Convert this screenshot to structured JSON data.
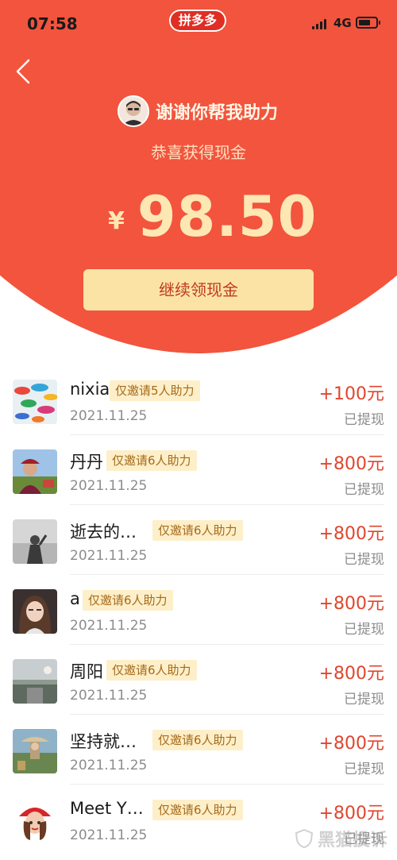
{
  "status_bar": {
    "time": "07:58",
    "app_badge": "拼多多",
    "network": "4G",
    "battery": 0.5
  },
  "back_icon": "chevron-left-icon",
  "header": {
    "thanks": "谢谢你帮我助力",
    "congrats": "恭喜获得现金",
    "currency": "¥",
    "amount": "98.50",
    "cta": "继续领现金"
  },
  "records": [
    {
      "name": "nixia",
      "tag": "仅邀请5人助力",
      "date": "2021.11.25",
      "amount": "+100元",
      "status": "已提现"
    },
    {
      "name": "丹丹",
      "tag": "仅邀请6人助力",
      "date": "2021.11.25",
      "amount": "+800元",
      "status": "已提现"
    },
    {
      "name": "逝去的…",
      "tag": "仅邀请6人助力",
      "date": "2021.11.25",
      "amount": "+800元",
      "status": "已提现"
    },
    {
      "name": "a",
      "tag": "仅邀请6人助力",
      "date": "2021.11.25",
      "amount": "+800元",
      "status": "已提现"
    },
    {
      "name": "周阳",
      "tag": "仅邀请6人助力",
      "date": "2021.11.25",
      "amount": "+800元",
      "status": "已提现"
    },
    {
      "name": "坚持就…",
      "tag": "仅邀请6人助力",
      "date": "2021.11.25",
      "amount": "+800元",
      "status": "已提现"
    },
    {
      "name": "Meet Y…",
      "tag": "仅邀请6人助力",
      "date": "2021.11.25",
      "amount": "+800元",
      "status": "已提现"
    }
  ],
  "watermark": "黑猫投诉",
  "colors": {
    "hero": "#f2543d",
    "button": "#fbe3a6",
    "amount": "#fde7b3",
    "accent": "#e0462f",
    "tag_bg": "#fdefc9"
  }
}
